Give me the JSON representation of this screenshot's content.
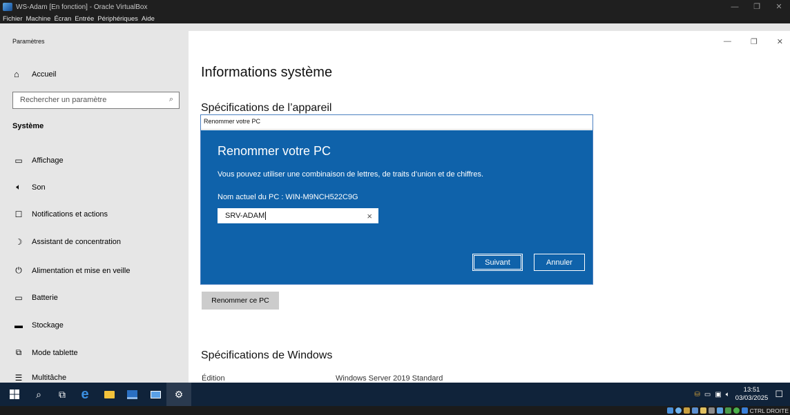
{
  "vbox": {
    "title": "WS-Adam [En fonction] - Oracle VirtualBox",
    "menu": [
      "Fichier",
      "Machine",
      "Écran",
      "Entrée",
      "Périphériques",
      "Aide"
    ],
    "status_key": "CTRL DROITE"
  },
  "window": {
    "title": "Paramètres"
  },
  "sidebar": {
    "home": "Accueil",
    "search_placeholder": "Rechercher un paramètre",
    "section": "Système",
    "items": [
      {
        "label": "Affichage",
        "icon": "monitor-icon"
      },
      {
        "label": "Son",
        "icon": "speaker-icon"
      },
      {
        "label": "Notifications et actions",
        "icon": "notification-icon"
      },
      {
        "label": "Assistant de concentration",
        "icon": "moon-icon"
      },
      {
        "label": "Alimentation et mise en veille",
        "icon": "power-icon"
      },
      {
        "label": "Batterie",
        "icon": "battery-icon"
      },
      {
        "label": "Stockage",
        "icon": "storage-icon"
      },
      {
        "label": "Mode tablette",
        "icon": "tablet-icon"
      },
      {
        "label": "Multitâche",
        "icon": "multitask-icon"
      }
    ]
  },
  "main": {
    "title": "Informations système",
    "device_specs": "Spécifications de l’appareil",
    "rename_button": "Renommer ce PC",
    "windows_specs": "Spécifications de Windows",
    "edition_label": "Édition",
    "edition_value": "Windows Server 2019 Standard"
  },
  "dialog": {
    "window_title": "Renommer votre PC",
    "heading": "Renommer votre PC",
    "info": "Vous pouvez utiliser une combinaison de lettres, de traits d’union et de chiffres.",
    "current_name": "Nom actuel du PC : WIN-M9NCH522C9G",
    "input_value": "SRV-ADAM",
    "next_button": "Suivant",
    "cancel_button": "Annuler"
  },
  "taskbar": {
    "time": "13:51",
    "date": "03/03/2025"
  },
  "colors": {
    "dialog_blue": "#0f62aa",
    "taskbar": "#10233a"
  }
}
